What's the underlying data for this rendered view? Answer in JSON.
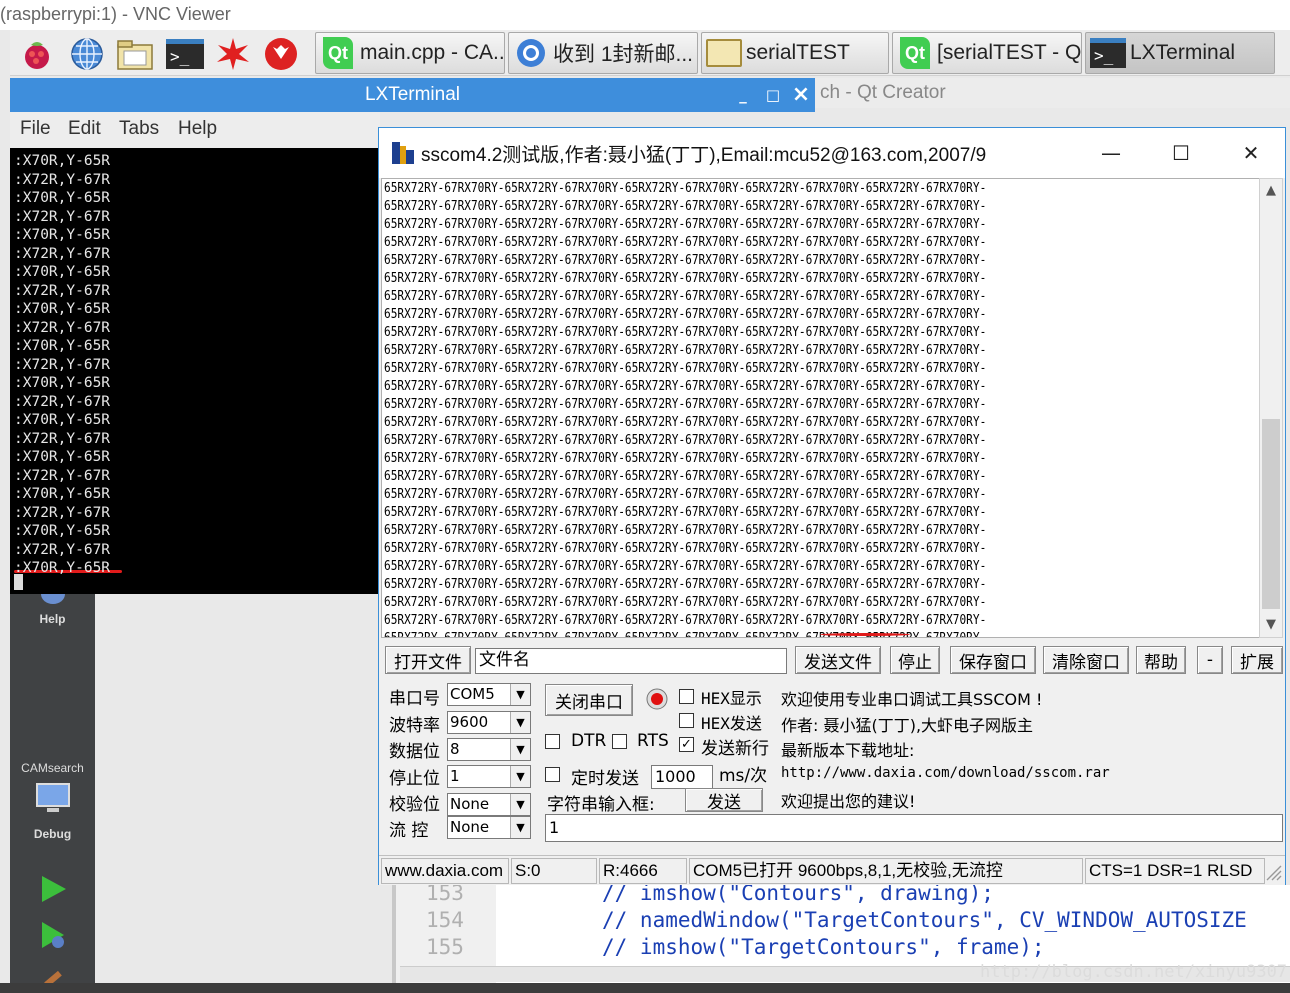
{
  "vnc": {
    "title": "(raspberrypi:1) - VNC Viewer"
  },
  "taskbar": {
    "launchers": [
      "raspberry-menu-icon",
      "web-browser-icon",
      "file-manager-icon",
      "terminal-icon",
      "math-icon",
      "wolfram-icon"
    ],
    "tasks": [
      {
        "label": "main.cpp - CA...",
        "icon": "qt-icon"
      },
      {
        "label": "收到 1封新邮...",
        "icon": "mail-icon"
      },
      {
        "label": "serialTEST",
        "icon": "folder-icon"
      },
      {
        "label": "[serialTEST - Q...",
        "icon": "qt-icon"
      },
      {
        "label": "LXTerminal",
        "icon": "terminal-icon"
      }
    ]
  },
  "qt_creator": {
    "title_fragment": "ch - Qt Creator",
    "sidebar": {
      "help": "Help",
      "camsearch": "CAMsearch",
      "debug": "Debug"
    },
    "line_numbers": [
      "153",
      "154",
      "155"
    ],
    "code_lines": [
      "// imshow(\"Contours\", drawing);",
      "// namedWindow(\"TargetContours\", CV_WINDOW_AUTOSIZE",
      "// imshow(\"TargetContours\", frame);"
    ],
    "watermark": "http://blog.csdn.net/xinyu9307"
  },
  "lxterminal": {
    "title": "LXTerminal",
    "controls": {
      "minimize": "_",
      "maximize": "□",
      "close": "×"
    },
    "menu": [
      "File",
      "Edit",
      "Tabs",
      "Help"
    ],
    "lines": [
      ":X70R,Y-65R",
      ":X72R,Y-67R",
      ":X70R,Y-65R",
      ":X72R,Y-67R",
      ":X70R,Y-65R",
      ":X72R,Y-67R",
      ":X70R,Y-65R",
      ":X72R,Y-67R",
      ":X70R,Y-65R",
      ":X72R,Y-67R",
      ":X70R,Y-65R",
      ":X72R,Y-67R",
      ":X70R,Y-65R",
      ":X72R,Y-67R",
      ":X70R,Y-65R",
      ":X72R,Y-67R",
      ":X70R,Y-65R",
      ":X72R,Y-67R",
      ":X70R,Y-65R",
      ":X72R,Y-67R",
      ":X70R,Y-65R",
      ":X72R,Y-67R",
      ":X70R,Y-65R"
    ]
  },
  "sscom": {
    "title": "sscom4.2测试版,作者:聂小猛(丁丁),Email:mcu52@163.com,2007/9",
    "window_controls": {
      "minimize": "—",
      "maximize": "☐",
      "close": "✕"
    },
    "receive_lines": [
      "65RX72RY-67RX70RY-65RX72RY-67RX70RY-65RX72RY-67RX70RY-65RX72RY-67RX70RY-65RX72RY-67RX70RY-",
      "65RX72RY-67RX70RY-65RX72RY-67RX70RY-65RX72RY-67RX70RY-65RX72RY-67RX70RY-65RX72RY-67RX70RY-",
      "65RX72RY-67RX70RY-65RX72RY-67RX70RY-65RX72RY-67RX70RY-65RX72RY-67RX70RY-65RX72RY-67RX70RY-",
      "65RX72RY-67RX70RY-65RX72RY-67RX70RY-65RX72RY-67RX70RY-65RX72RY-67RX70RY-65RX72RY-67RX70RY-",
      "65RX72RY-67RX70RY-65RX72RY-67RX70RY-65RX72RY-67RX70RY-65RX72RY-67RX70RY-65RX72RY-67RX70RY-",
      "65RX72RY-67RX70RY-65RX72RY-67RX70RY-65RX72RY-67RX70RY-65RX72RY-67RX70RY-65RX72RY-67RX70RY-",
      "65RX72RY-67RX70RY-65RX72RY-67RX70RY-65RX72RY-67RX70RY-65RX72RY-67RX70RY-65RX72RY-67RX70RY-",
      "65RX72RY-67RX70RY-65RX72RY-67RX70RY-65RX72RY-67RX70RY-65RX72RY-67RX70RY-65RX72RY-67RX70RY-",
      "65RX72RY-67RX70RY-65RX72RY-67RX70RY-65RX72RY-67RX70RY-65RX72RY-67RX70RY-65RX72RY-67RX70RY-",
      "65RX72RY-67RX70RY-65RX72RY-67RX70RY-65RX72RY-67RX70RY-65RX72RY-67RX70RY-65RX72RY-67RX70RY-",
      "65RX72RY-67RX70RY-65RX72RY-67RX70RY-65RX72RY-67RX70RY-65RX72RY-67RX70RY-65RX72RY-67RX70RY-",
      "65RX72RY-67RX70RY-65RX72RY-67RX70RY-65RX72RY-67RX70RY-65RX72RY-67RX70RY-65RX72RY-67RX70RY-",
      "65RX72RY-67RX70RY-65RX72RY-67RX70RY-65RX72RY-67RX70RY-65RX72RY-67RX70RY-65RX72RY-67RX70RY-",
      "65RX72RY-67RX70RY-65RX72RY-67RX70RY-65RX72RY-67RX70RY-65RX72RY-67RX70RY-65RX72RY-67RX70RY-",
      "65RX72RY-67RX70RY-65RX72RY-67RX70RY-65RX72RY-67RX70RY-65RX72RY-67RX70RY-65RX72RY-67RX70RY-",
      "65RX72RY-67RX70RY-65RX72RY-67RX70RY-65RX72RY-67RX70RY-65RX72RY-67RX70RY-65RX72RY-67RX70RY-",
      "65RX72RY-67RX70RY-65RX72RY-67RX70RY-65RX72RY-67RX70RY-65RX72RY-67RX70RY-65RX72RY-67RX70RY-",
      "65RX72RY-67RX70RY-65RX72RY-67RX70RY-65RX72RY-67RX70RY-65RX72RY-67RX70RY-65RX72RY-67RX70RY-",
      "65RX72RY-67RX70RY-65RX72RY-67RX70RY-65RX72RY-67RX70RY-65RX72RY-67RX70RY-65RX72RY-67RX70RY-",
      "65RX72RY-67RX70RY-65RX72RY-67RX70RY-65RX72RY-67RX70RY-65RX72RY-67RX70RY-65RX72RY-67RX70RY-",
      "65RX72RY-67RX70RY-65RX72RY-67RX70RY-65RX72RY-67RX70RY-65RX72RY-67RX70RY-65RX72RY-67RX70RY-",
      "65RX72RY-67RX70RY-65RX72RY-67RX70RY-65RX72RY-67RX70RY-65RX72RY-67RX70RY-65RX72RY-67RX70RY-",
      "65RX72RY-67RX70RY-65RX72RY-67RX70RY-65RX72RY-67RX70RY-65RX72RY-67RX70RY-65RX72RY-67RX70RY-",
      "65RX72RY-67RX70RY-65RX72RY-67RX70RY-65RX72RY-67RX70RY-65RX72RY-67RX70RY-65RX72RY-67RX70RY-",
      "65RX72RY-67RX70RY-65RX72RY-67RX70RY-65RX72RY-67RX70RY-65RX72RY-67RX70RY-65RX72RY-67RX70RY-",
      "65RX72RY-67RX70RY-65RX72RY-67RX70RY-65RX72RY-67RX70RY-65RX72RY-67RX70RY-65RX72RY-67RX70RY-",
      "65RX72RY-67RX70RY-65RX72RY-67RX70RY-65RX72RY-67RX70RY-65RX72RY-67RX70RY-65RX72RY-67RX70RY-",
      "65RX72RY-67RX70RY-65RX72RY-67RX70RY-65RX72RY-67RX70RY-65RX72RY-67RX70RY-65R"
    ],
    "file_row": {
      "open_file": "打开文件",
      "filename": "文件名",
      "send_file": "发送文件",
      "stop": "停止",
      "save_window": "保存窗口",
      "clear_window": "清除窗口",
      "help": "帮助",
      "minus": "-",
      "expand": "扩展"
    },
    "settings": {
      "port_label": "串口号",
      "port_value": "COM5",
      "baud_label": "波特率",
      "baud_value": "9600",
      "databits_label": "数据位",
      "databits_value": "8",
      "stopbits_label": "停止位",
      "stopbits_value": "1",
      "parity_label": "校验位",
      "parity_value": "None",
      "flow_label": "流 控",
      "flow_value": "None"
    },
    "controls": {
      "close_port": "关闭串口",
      "hex_display": "HEX显示",
      "hex_send": "HEX发送",
      "dtr": "DTR",
      "rts": "RTS",
      "send_newline": "发送新行",
      "timed_send": "定时发送",
      "interval_value": "1000",
      "interval_unit": "ms/次",
      "string_input": "字符串输入框:",
      "send": "发送",
      "send_text": "1"
    },
    "info": [
      "欢迎使用专业串口调试工具SSCOM !",
      "作者: 聂小猛(丁丁),大虾电子网版主",
      "最新版本下载地址:",
      "http://www.daxia.com/download/sscom.rar",
      "欢迎提出您的建议!"
    ],
    "status": {
      "site": "www.daxia.com",
      "sent": "S:0",
      "received": "R:4666",
      "port_state": "COM5已打开  9600bps,8,1,无校验,无流控",
      "lines": "CTS=1 DSR=1 RLSD"
    }
  },
  "colors": {
    "terminal_titlebar": "#3e8edc",
    "annotation": "#e11b1b"
  }
}
